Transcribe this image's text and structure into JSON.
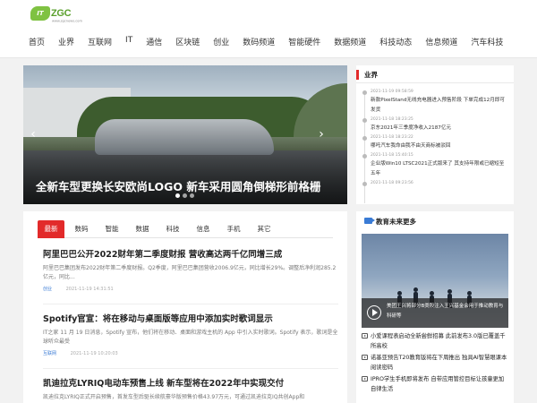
{
  "logo": {
    "badge": "IT",
    "brand": "ZGC",
    "subtitle": "www.zgcnews.com"
  },
  "nav": [
    "首页",
    "业界",
    "互联网",
    "IT",
    "通信",
    "区块链",
    "创业",
    "数码频道",
    "智能硬件",
    "数据频道",
    "科技动态",
    "信息频道",
    "汽车科技"
  ],
  "hero": {
    "title": "全新车型更换长安欧尚LOGO 新车采用圆角倒梯形前格栅",
    "prev_icon": "chevron-left-icon",
    "next_icon": "chevron-right-icon",
    "slide_count": 3,
    "active_slide": 0
  },
  "tabs": {
    "items": [
      "最新",
      "数码",
      "智能",
      "数据",
      "科技",
      "信息",
      "手机",
      "其它"
    ],
    "active": 0,
    "accent": "#e22a2a"
  },
  "articles": [
    {
      "title": "阿里巴巴公开2022财年第二季度财报 营收高达两千亿同增三成",
      "summary": "阿里巴巴集团发布2022财年第二季度财报。Q2季度，阿里巴巴集团营收2006.9亿元，同比增长29%。调整后净利润285.2亿元，同比...",
      "category": "创业",
      "time": "2021-11-19 14:31:51"
    },
    {
      "title": "Spotify官宣：将在移动与桌面版等应用中添加实时歌词显示",
      "summary": "IT之家 11 月 19 日消息，Spotify 宣布，他们将在移动、桌面和游戏主机的 App 中引入实时歌词。Spotify 表示，歌词是全球听众最受",
      "category": "互联网",
      "time": "2021-11-19 10:20:03"
    },
    {
      "title": "凯迪拉克LYRIQ电动车预售上线 新车型将在2022年中实现交付",
      "summary": "凯迪拉克LYRIQ正式开启预售，首发车型后驱长续航豪华版预售价格43.97万元，可通过凯迪拉克IQ共创App和",
      "category": "",
      "time": ""
    }
  ],
  "industry": {
    "title": "业界",
    "accent": "#e22a2a",
    "timeline": [
      {
        "time": "2021-11-19 09:58:59",
        "text": "新款PixelStand无线充电器进入预售阶段 下单完成12月即可发货"
      },
      {
        "time": "2021-11-18 18:23:25",
        "text": "京东2021年三季度净收入2187亿元"
      },
      {
        "time": "2021-11-18 18:23:22",
        "text": "哪吒汽车我命由我不由天商标被驳回"
      },
      {
        "time": "2021-11-18 15:40:15",
        "text": "企业版Win10 LTSC2021正式版来了 其支持年限或已缩短至五年"
      },
      {
        "time": "2021-11-18 09:23:56",
        "text": ""
      }
    ]
  },
  "education": {
    "title": "教育未来更多",
    "icon": "video-camera-icon",
    "accent": "#3a7bd5",
    "video_caption": "美团王兴将部分B类股注入王兴基金会用于推动教育与科研等",
    "play_icon": "play-icon",
    "items": [
      "小爱课程表启动全新尝鲜招募 此前发布3.0版已覆盖千所高校",
      "诺基亚预告T20教育版将在下周推出 独具AI智慧眼课本阅读密码",
      "IPRO学生手机即将发布 自带应用管控目标让孩童更加自律生活"
    ]
  }
}
